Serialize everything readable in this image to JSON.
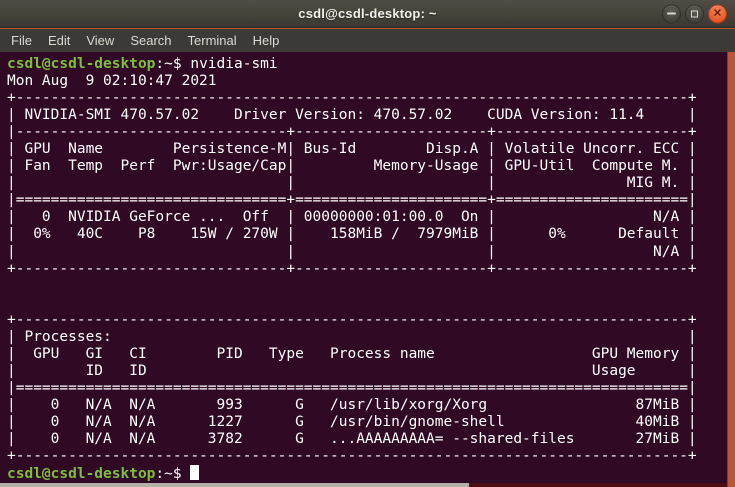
{
  "window": {
    "title": "csdl@csdl-desktop: ~",
    "buttons": [
      {
        "name": "minimize"
      },
      {
        "name": "maximize"
      },
      {
        "name": "close"
      }
    ]
  },
  "menubar": {
    "items": [
      "File",
      "Edit",
      "View",
      "Search",
      "Terminal",
      "Help"
    ]
  },
  "terminal": {
    "colors": {
      "background": "#300A24",
      "foreground": "#FFFFFF",
      "prompt_green": "#7FBE3C",
      "cursor": "#FFFFFF"
    },
    "prompt": {
      "user_host": "csdl@csdl-desktop",
      "separator": ":",
      "path": "~",
      "dollar": "$"
    },
    "lines": [
      {
        "type": "prompt",
        "user_host": "csdl@csdl-desktop",
        "separator": ":",
        "path": "~",
        "dollar": "$",
        "command": "nvidia-smi",
        "cursor": false
      },
      {
        "type": "text",
        "text": "Mon Aug  9 02:10:47 2021       "
      },
      {
        "type": "text",
        "text": "+-----------------------------------------------------------------------------+"
      },
      {
        "type": "text",
        "text": "| NVIDIA-SMI 470.57.02    Driver Version: 470.57.02    CUDA Version: 11.4     |"
      },
      {
        "type": "text",
        "text": "|-------------------------------+----------------------+----------------------+"
      },
      {
        "type": "text",
        "text": "| GPU  Name        Persistence-M| Bus-Id        Disp.A | Volatile Uncorr. ECC |"
      },
      {
        "type": "text",
        "text": "| Fan  Temp  Perf  Pwr:Usage/Cap|         Memory-Usage | GPU-Util  Compute M. |"
      },
      {
        "type": "text",
        "text": "|                               |                      |               MIG M. |"
      },
      {
        "type": "text",
        "text": "|===============================+======================+======================|"
      },
      {
        "type": "text",
        "text": "|   0  NVIDIA GeForce ...  Off  | 00000000:01:00.0  On |                  N/A |"
      },
      {
        "type": "text",
        "text": "|  0%   40C    P8    15W / 270W |    158MiB /  7979MiB |      0%      Default |"
      },
      {
        "type": "text",
        "text": "|                               |                      |                  N/A |"
      },
      {
        "type": "text",
        "text": "+-------------------------------+----------------------+----------------------+"
      },
      {
        "type": "text",
        "text": " "
      },
      {
        "type": "text",
        "text": " "
      },
      {
        "type": "text",
        "text": "+-----------------------------------------------------------------------------+"
      },
      {
        "type": "text",
        "text": "| Processes:                                                                  |"
      },
      {
        "type": "text",
        "text": "|  GPU   GI   CI        PID   Type   Process name                  GPU Memory |"
      },
      {
        "type": "text",
        "text": "|        ID   ID                                                   Usage      |"
      },
      {
        "type": "text",
        "text": "|=============================================================================|"
      },
      {
        "type": "text",
        "text": "|    0   N/A  N/A       993      G   /usr/lib/xorg/Xorg                 87MiB |"
      },
      {
        "type": "text",
        "text": "|    0   N/A  N/A      1227      G   /usr/bin/gnome-shell               40MiB |"
      },
      {
        "type": "text",
        "text": "|    0   N/A  N/A      3782      G   ...AAAAAAAAA= --shared-files       27MiB |"
      },
      {
        "type": "text",
        "text": "+-----------------------------------------------------------------------------+"
      },
      {
        "type": "prompt",
        "user_host": "csdl@csdl-desktop",
        "separator": ":",
        "path": "~",
        "dollar": "$",
        "command": "",
        "cursor": true
      }
    ]
  },
  "desktop": {
    "right_strip_color": "#BD5533",
    "bottom_left_strip_color": "#B4B0AA",
    "bottom_right_strip_color": "#4E0D13"
  }
}
